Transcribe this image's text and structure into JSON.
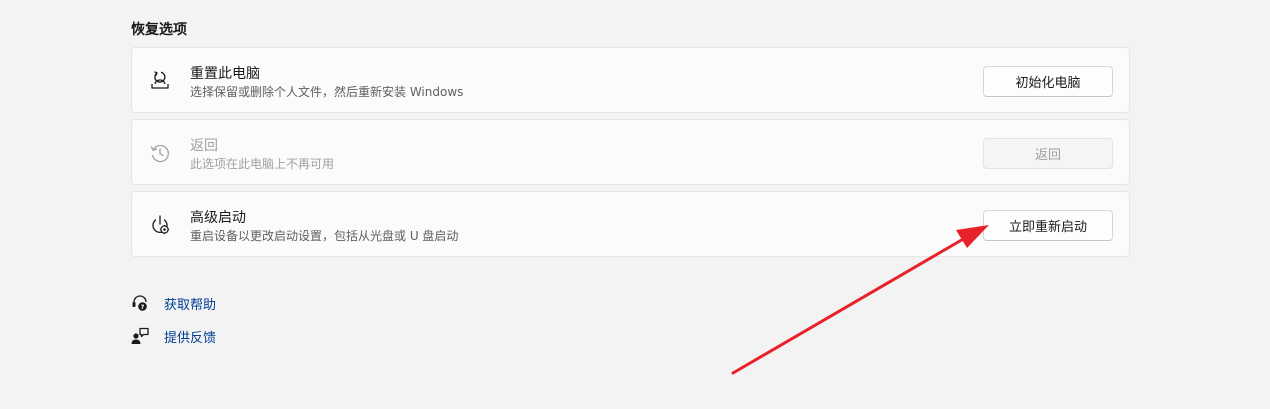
{
  "section": {
    "title": "恢复选项"
  },
  "options": [
    {
      "title": "重置此电脑",
      "description": "选择保留或删除个人文件，然后重新安装 Windows",
      "button": "初始化电脑",
      "enabled": true
    },
    {
      "title": "返回",
      "description": "此选项在此电脑上不再可用",
      "button": "返回",
      "enabled": false
    },
    {
      "title": "高级启动",
      "description": "重启设备以更改启动设置，包括从光盘或 U 盘启动",
      "button": "立即重新启动",
      "enabled": true
    }
  ],
  "links": [
    {
      "label": "获取帮助",
      "icon": "help-icon"
    },
    {
      "label": "提供反馈",
      "icon": "feedback-icon"
    }
  ],
  "colors": {
    "background": "#f3f3f3",
    "card": "#fbfbfb",
    "link": "#003e92",
    "annotation_arrow": "#e8222a"
  }
}
